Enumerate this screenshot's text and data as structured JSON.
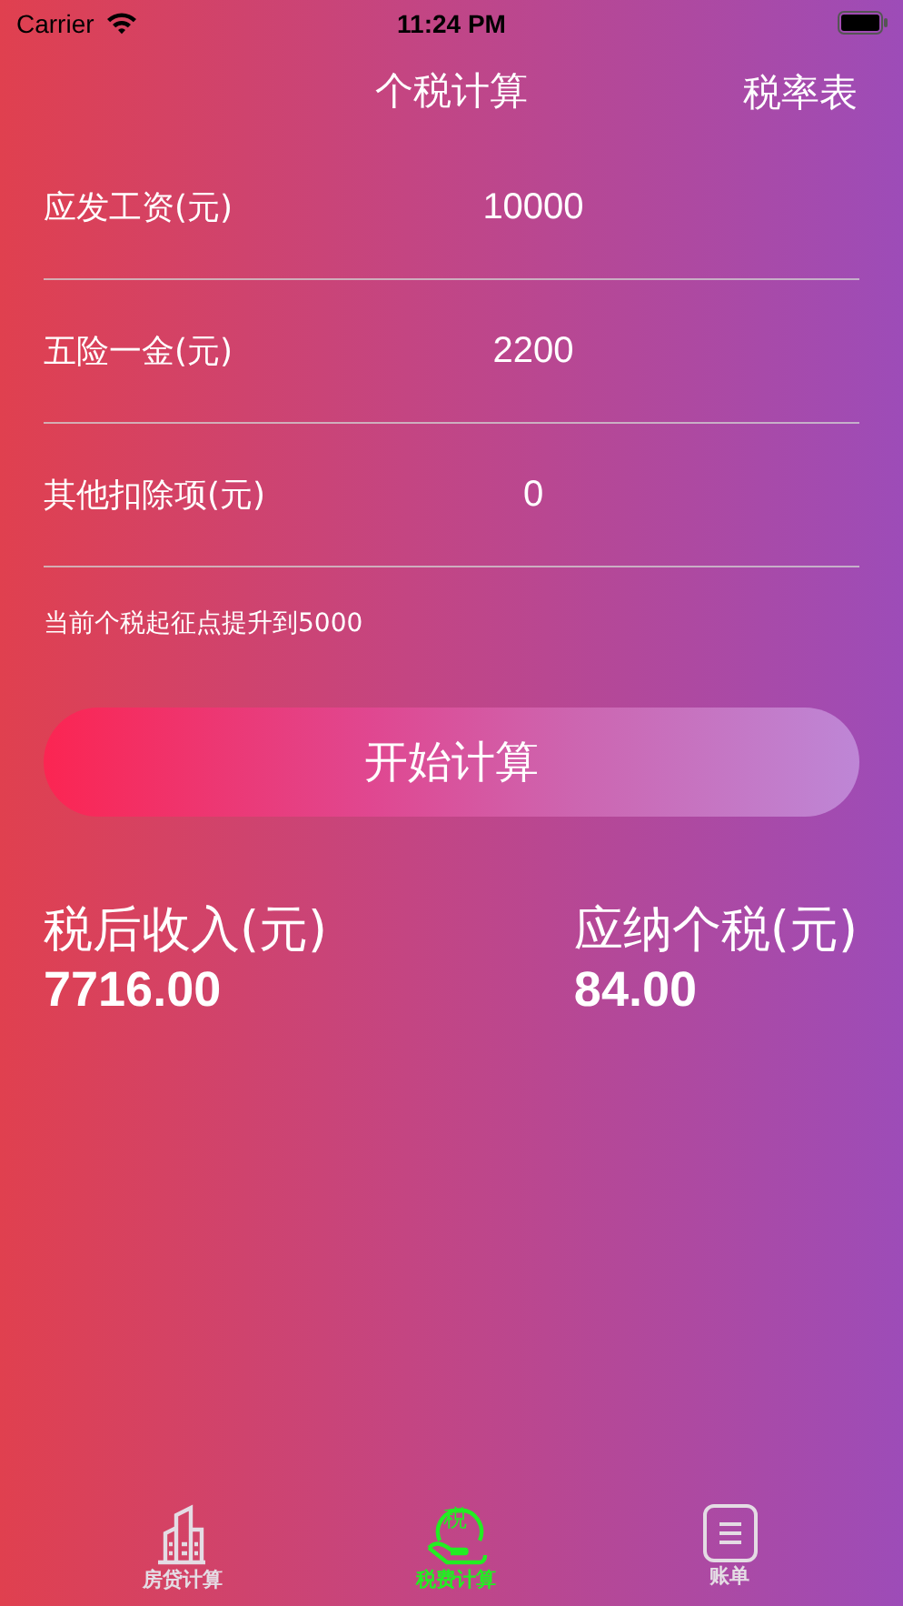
{
  "status_bar": {
    "carrier": "Carrier",
    "time": "11:24 PM"
  },
  "nav": {
    "title": "个税计算",
    "right_button": "税率表"
  },
  "fields": [
    {
      "label": "应发工资(元)",
      "value": "10000"
    },
    {
      "label": "五险一金(元)",
      "value": "2200"
    },
    {
      "label": "其他扣除项(元)",
      "value": "0"
    }
  ],
  "hint": "当前个税起征点提升到5000",
  "calculate_button": "开始计算",
  "results": [
    {
      "label": "税后收入(元)",
      "value": "7716.00"
    },
    {
      "label": "应纳个税(元)",
      "value": "84.00"
    }
  ],
  "tabs": [
    {
      "kind": "building",
      "label": "房贷计算",
      "selected": false
    },
    {
      "kind": "tax",
      "label": "税费计算",
      "glyph": "税",
      "selected": true
    },
    {
      "kind": "list",
      "label": "账单",
      "selected": false
    }
  ]
}
